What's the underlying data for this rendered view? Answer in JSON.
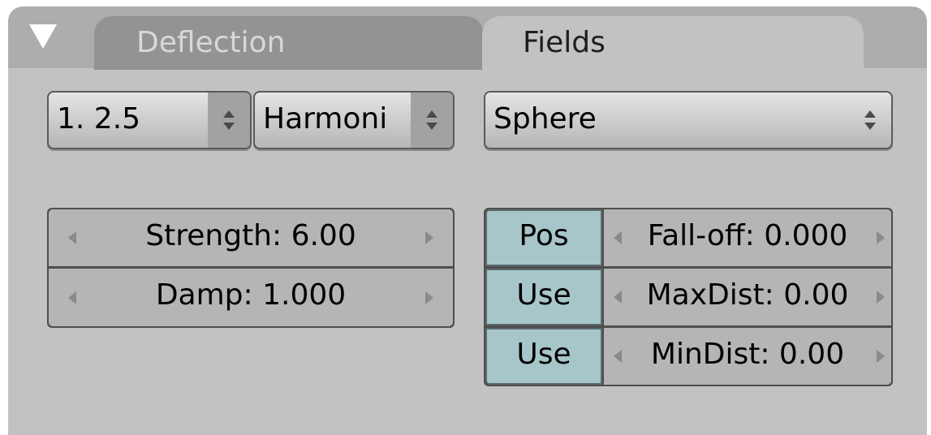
{
  "tabs": {
    "deflection": "Deflection",
    "fields": "Fields",
    "active": "Fields"
  },
  "selectors": {
    "version": "1. 2.5",
    "falloff_mode": "Harmoni",
    "shape": "Sphere"
  },
  "left_fields": {
    "strength": "Strength: 6.00",
    "damp": "Damp: 1.000"
  },
  "right_fields": {
    "toggle_pos": "Pos",
    "falloff": "Fall-off: 0.000",
    "toggle_use_max": "Use",
    "maxdist": "MaxDist: 0.00",
    "toggle_use_min": "Use",
    "mindist": "MinDist: 0.00"
  },
  "colors": {
    "panel_bg": "#c2c2c2",
    "toggle_active": "#a7c6c9",
    "number_field": "#b5b5b5",
    "tab_inactive": "#939393"
  },
  "icons": {
    "collapse": "triangle-down-icon",
    "selector_arrows": "up-down-arrow-icon",
    "field_left": "left-arrow-icon",
    "field_right": "right-arrow-icon"
  }
}
